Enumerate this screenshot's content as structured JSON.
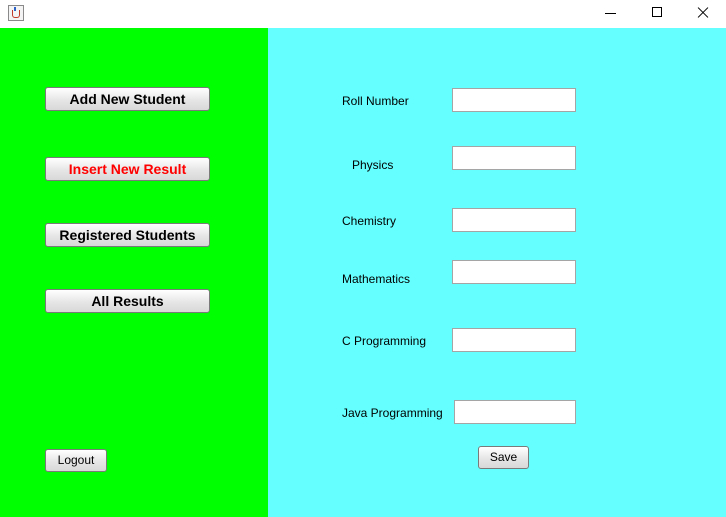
{
  "window": {
    "title": ""
  },
  "sidebar": {
    "add_student": "Add New Student",
    "insert_result": "Insert New Result",
    "registered_students": "Registered Students",
    "all_results": "All Results",
    "logout": "Logout"
  },
  "form": {
    "roll_number": {
      "label": "Roll Number",
      "value": ""
    },
    "physics": {
      "label": "Physics",
      "value": ""
    },
    "chemistry": {
      "label": "Chemistry",
      "value": ""
    },
    "mathematics": {
      "label": "Mathematics",
      "value": ""
    },
    "c_programming": {
      "label": "C Programming",
      "value": ""
    },
    "java_programming": {
      "label": "Java Programming",
      "value": ""
    },
    "save": "Save"
  },
  "colors": {
    "sidebar_bg": "#00ff00",
    "form_bg": "#66ffff",
    "active_text": "#ff0000"
  },
  "icons": [
    "java-app-icon",
    "minimize-icon",
    "maximize-icon",
    "close-icon"
  ]
}
